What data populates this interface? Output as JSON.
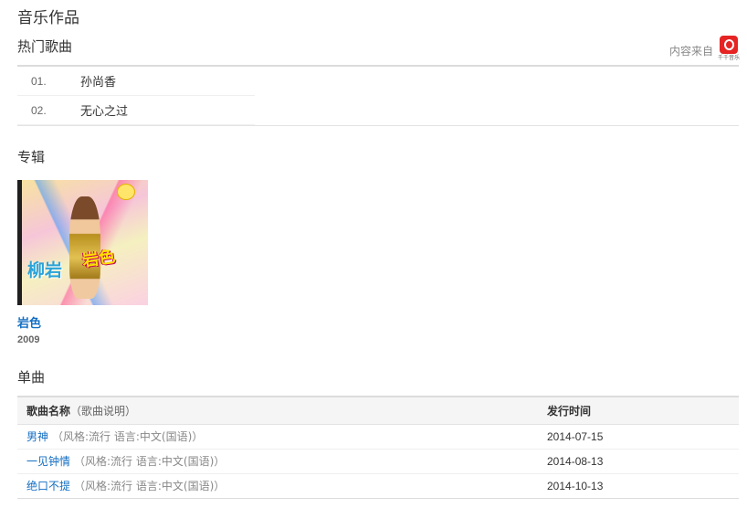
{
  "page": {
    "title": "音乐作品"
  },
  "hot_songs": {
    "title": "热门歌曲",
    "source_label": "内容来自",
    "source_logo_text": "千千音乐",
    "items": [
      {
        "num": "01.",
        "name": "孙尚香"
      },
      {
        "num": "02.",
        "name": "无心之过"
      }
    ]
  },
  "albums": {
    "title": "专辑",
    "items": [
      {
        "name": "岩色",
        "year": "2009",
        "cover_title": "岩色",
        "cover_artist": "柳岩"
      }
    ]
  },
  "singles": {
    "title": "单曲",
    "columns": {
      "name": "歌曲名称",
      "name_hint": "（歌曲说明）",
      "date": "发行时间"
    },
    "rows": [
      {
        "name": "男神",
        "desc": "（风格:流行 语言:中文(国语)）",
        "date": "2014-07-15"
      },
      {
        "name": "一见钟情",
        "desc": "（风格:流行 语言:中文(国语)）",
        "date": "2014-08-13"
      },
      {
        "name": "绝口不提",
        "desc": "（风格:流行 语言:中文(国语)）",
        "date": "2014-10-13"
      }
    ]
  },
  "colors": {
    "link": "#136ec2",
    "logo": "#e62424"
  }
}
